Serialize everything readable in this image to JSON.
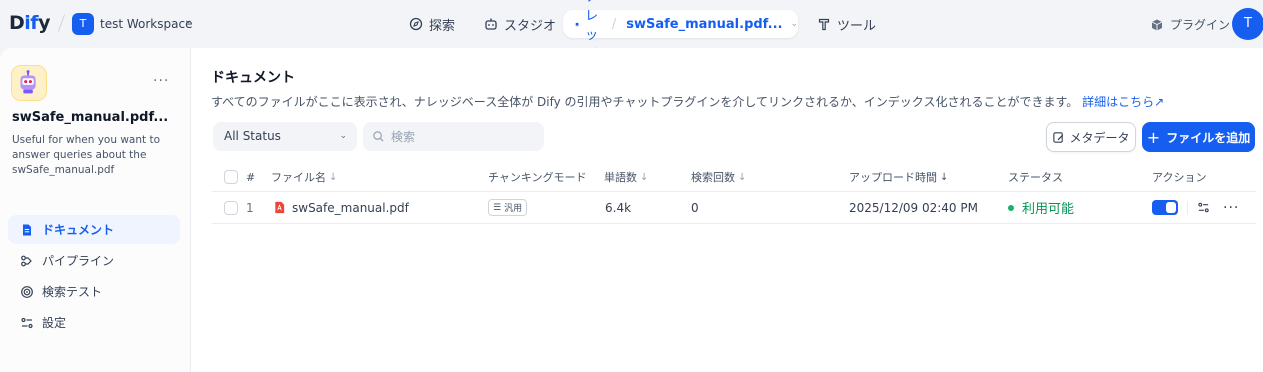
{
  "header": {
    "logo_main": "D",
    "logo_accent": "if",
    "logo_tail": "y",
    "workspace_initial": "T",
    "workspace_name": "test Workspace",
    "nav": {
      "explore": "探索",
      "studio": "スタジオ",
      "knowledge": "ナレッジ",
      "dataset": "swSafe_manual.pdf...",
      "tools": "ツール"
    },
    "plugin": "プラグイン",
    "avatar_initial": "T"
  },
  "sidebar": {
    "dataset_title": "swSafe_manual.pdf...",
    "description": "Useful for when you want to answer queries about the swSafe_manual.pdf",
    "more": "···",
    "items": [
      {
        "label": "ドキュメント",
        "icon": "document-icon",
        "active": true
      },
      {
        "label": "パイプライン",
        "icon": "pipeline-icon",
        "active": false
      },
      {
        "label": "検索テスト",
        "icon": "target-icon",
        "active": false
      },
      {
        "label": "設定",
        "icon": "settings-icon",
        "active": false
      }
    ]
  },
  "main": {
    "title": "ドキュメント",
    "description": "すべてのファイルがここに表示され、ナレッジベース全体が Dify の引用やチャットプラグインを介してリンクされるか、インデックス化されることができます。",
    "learn_more": "詳細はこちら",
    "status_filter": "All Status",
    "search_placeholder": "検索",
    "metadata_button": "メタデータ",
    "add_file_button": "ファイルを追加",
    "columns": {
      "num": "#",
      "filename": "ファイル名",
      "chunk_mode": "チャンキングモード",
      "words": "単語数",
      "hits": "検索回数",
      "upload_time": "アップロード時間",
      "status": "ステータス",
      "action": "アクション"
    },
    "rows": [
      {
        "num": "1",
        "filename": "swSafe_manual.pdf",
        "chunk_mode": "汎用",
        "words": "6.4k",
        "hits": "0",
        "upload_time": "2025/12/09 02:40 PM",
        "status": "利用可能",
        "enabled": true
      }
    ]
  },
  "colors": {
    "accent": "#155eef",
    "status_available": "#17b26a",
    "pdf_red": "#f04438"
  }
}
